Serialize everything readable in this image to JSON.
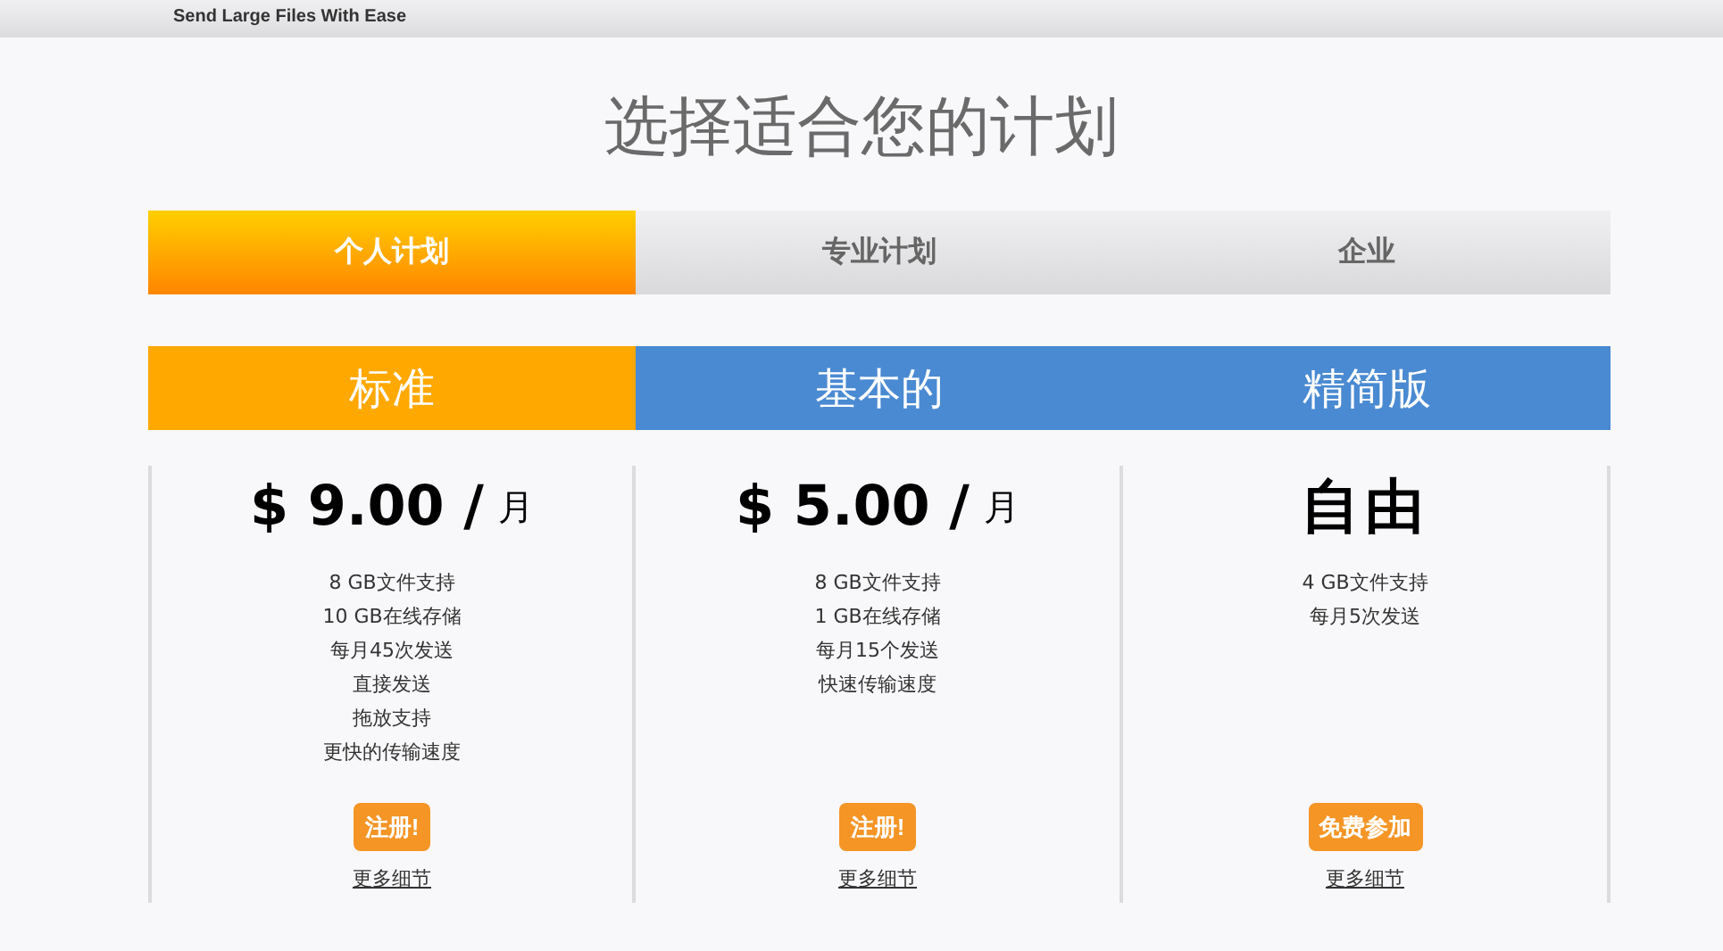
{
  "header": {
    "tagline": "Send Large Files With Ease"
  },
  "title": "选择适合您的计划",
  "tabs": [
    {
      "label": "个人计划",
      "selected": true
    },
    {
      "label": "专业计划",
      "selected": false
    },
    {
      "label": "企业",
      "selected": false
    }
  ],
  "plans": [
    {
      "name": "标准",
      "color": "#ffa800",
      "kind": "paid",
      "price": "$ 9.00 /",
      "unit": "月",
      "features": [
        "8 GB文件支持",
        "10 GB在线存储",
        "每月45次发送",
        "直接发送",
        "拖放支持",
        "更快的传输速度"
      ],
      "button": "注册!",
      "link": "更多细节"
    },
    {
      "name": "基本的",
      "color": "#4a8ad2",
      "kind": "paid",
      "price": "$ 5.00 /",
      "unit": "月",
      "features": [
        "8 GB文件支持",
        "1 GB在线存储",
        "每月15个发送",
        "快速传输速度"
      ],
      "button": "注册!",
      "link": "更多细节"
    },
    {
      "name": "精简版",
      "color": "#4a8ad2",
      "kind": "free",
      "price": "自由",
      "features": [
        "4 GB文件支持",
        "每月5次发送"
      ],
      "button": "免费参加",
      "link": "更多细节"
    }
  ]
}
